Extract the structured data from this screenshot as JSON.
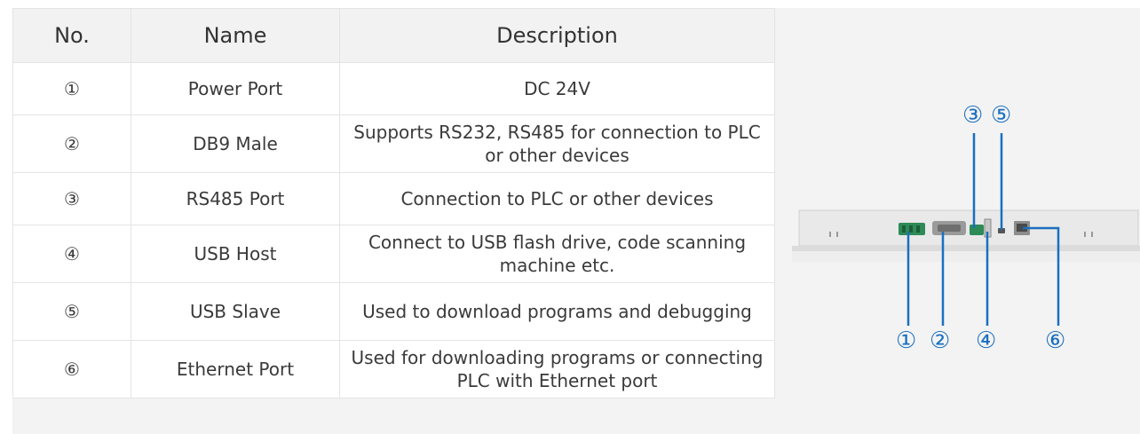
{
  "table": {
    "headers": {
      "no": "No.",
      "name": "Name",
      "description": "Description"
    },
    "rows": [
      {
        "no": "①",
        "name": "Power Port",
        "description": "DC 24V"
      },
      {
        "no": "②",
        "name": "DB9 Male",
        "description": "Supports RS232, RS485 for connection to PLC or other devices"
      },
      {
        "no": "③",
        "name": "RS485 Port",
        "description": "Connection to PLC or other devices"
      },
      {
        "no": "④",
        "name": "USB Host",
        "description": "Connect to USB flash drive, code scanning machine etc."
      },
      {
        "no": "⑤",
        "name": "USB Slave",
        "description": "Used to download programs and debugging"
      },
      {
        "no": "⑥",
        "name": "Ethernet Port",
        "description": "Used for downloading programs or connecting PLC with Ethernet port"
      }
    ]
  },
  "diagram": {
    "callouts_top": [
      "③",
      "⑤"
    ],
    "callouts_bottom": [
      "①",
      "②",
      "④",
      "⑥"
    ],
    "line_color": "#1a6fc0"
  }
}
